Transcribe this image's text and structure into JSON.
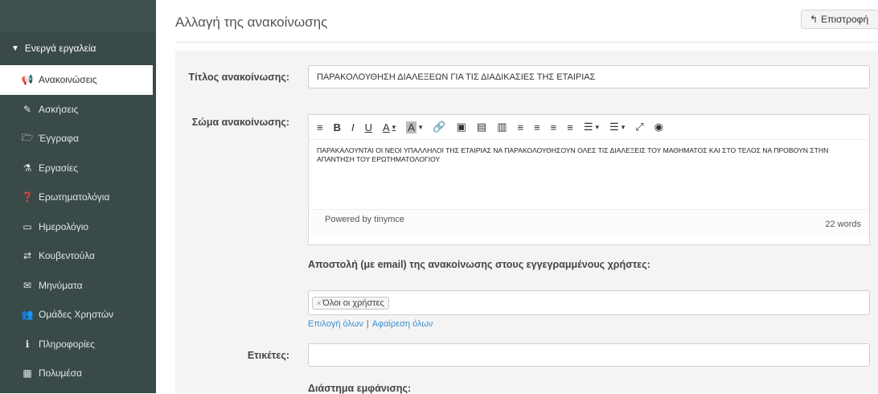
{
  "sidebar": {
    "section_label": "Ενεργά εργαλεία",
    "items": [
      {
        "label": "Ανακοινώσεις",
        "icon": "bullhorn-icon",
        "active": true
      },
      {
        "label": "Ασκήσεις",
        "icon": "pencil-square-icon"
      },
      {
        "label": "Έγγραφα",
        "icon": "folder-open-icon"
      },
      {
        "label": "Εργασίες",
        "icon": "flask-icon"
      },
      {
        "label": "Ερωτηματολόγια",
        "icon": "question-circle-icon"
      },
      {
        "label": "Ημερολόγιο",
        "icon": "calendar-icon"
      },
      {
        "label": "Κουβεντούλα",
        "icon": "exchange-icon"
      },
      {
        "label": "Μηνύματα",
        "icon": "envelope-icon"
      },
      {
        "label": "Ομάδες Χρηστών",
        "icon": "users-icon"
      },
      {
        "label": "Πληροφορίες",
        "icon": "info-circle-icon"
      },
      {
        "label": "Πολυμέσα",
        "icon": "film-icon"
      }
    ]
  },
  "header": {
    "title": "Αλλαγή της ανακοίνωσης",
    "back_label": "Επιστροφή"
  },
  "form": {
    "title_label": "Τίτλος ανακοίνωσης:",
    "title_value": "ΠΑΡΑΚΟΛΟΥΘΗΣΗ ΔΙΑΛΕΞΕΩΝ ΓΙΑ ΤΙΣ ΔΙΑΔΙΚΑΣΙΕΣ ΤΗΣ ΕΤΑΙΡΙΑΣ",
    "body_label": "Σώμα ανακοίνωσης:",
    "body_text": "ΠΑΡΑΚΑΛΟΥΝΤΑΙ ΟΙ ΝΕΟΙ ΥΠΑΛΛΗΛΟΙ ΤΗΣ ΕΤΑΙΡΙΑΣ ΝΑ ΠΑΡΑΚΟΛΟΥΘΗΣΟΥΝ ΟΛΕΣ ΤΙΣ ΔΙΑΛΕΞΕΙΣ ΤΟΥ ΜΑΘΗΜΑΤΟΣ ΚΑΙ ΣΤΟ ΤΕΛΟΣ ΝΑ ΠΡΟΒΟΥΝ ΣΤΗΝ ΑΠΑΝΤΗΣΗ ΤΟΥ ΕΡΩΤΗΜΑΤΟΛΟΓΙΟΥ",
    "powered_by": "Powered by tinymce",
    "word_count": "22 words",
    "email_label": "Αποστολή (με email) της ανακοίνωσης στους εγγεγραμμένους χρήστες:",
    "recipients_tag": "Όλοι οι χρήστες",
    "select_all": "Επιλογή όλων",
    "remove_all": "Αφαίρεση όλων",
    "tags_label": "Ετικέτες:",
    "display_period_label": "Διάστημα εμφάνισης:"
  },
  "toolbar": [
    "≡",
    "B",
    "I",
    "U",
    "A",
    "A",
    "🔗",
    "▣",
    "▤",
    "▥",
    "≡",
    "≡",
    "≡",
    "≡",
    "☰",
    "☰",
    "⤢",
    "◉"
  ]
}
